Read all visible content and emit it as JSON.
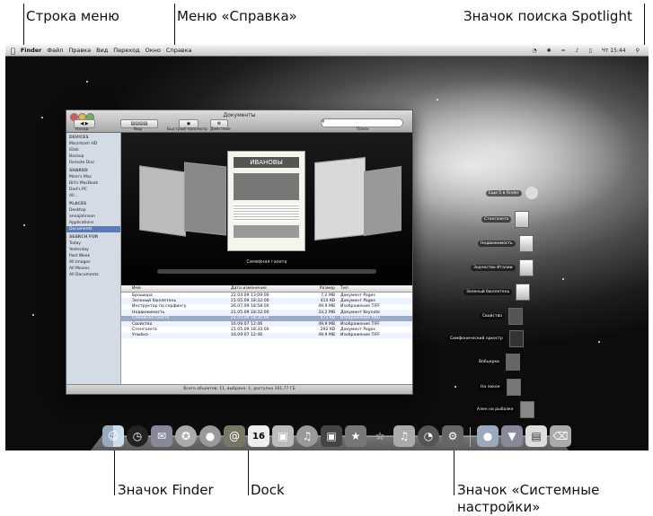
{
  "callouts": {
    "menu_bar": "Строка меню",
    "help_menu": "Меню «Справка»",
    "spotlight": "Значок поиска Spotlight",
    "finder_icon": "Значок Finder",
    "dock": "Dock",
    "sys_prefs_line1": "Значок «Системные",
    "sys_prefs_line2": "настройки»"
  },
  "menubar": {
    "apple": "",
    "items": [
      "Finder",
      "Файл",
      "Правка",
      "Вид",
      "Переход",
      "Окно",
      "Справка"
    ],
    "clock": "Чт 15:44"
  },
  "window": {
    "title": "Документы",
    "toolbar": {
      "back_label": "Назад",
      "view_label": "Вид",
      "quicklook_label": "Быстрый просмотр",
      "action_label": "Действие",
      "search_label": "Поиск"
    },
    "sidebar": {
      "devices_header": "DEVICES",
      "devices": [
        "Macintosh HD",
        "iDisk",
        "Backup",
        "Remote Disc"
      ],
      "shared_header": "SHARED",
      "shared": [
        "Mom's Mac",
        "Bill's MacBook",
        "Dad's PC",
        "All..."
      ],
      "places_header": "PLACES",
      "places": [
        "Desktop",
        "annajohnson",
        "Applications",
        "Documents"
      ],
      "search_header": "SEARCH FOR",
      "search": [
        "Today",
        "Yesterday",
        "Past Week",
        "All Images",
        "All Movies",
        "All Documents"
      ]
    },
    "coverflow": {
      "center_title": "ИВАНОВЫ",
      "caption": "Семейная газета"
    },
    "columns": {
      "name": "Имя",
      "date": "Дата изменения",
      "size": "Размер",
      "type": "Тип"
    },
    "rows": [
      {
        "name": "Брошюра",
        "date": "22.04.09 13:09:00",
        "size": "7,2 MB",
        "type": "Документ Pages"
      },
      {
        "name": "Зеленый бюллетень",
        "date": "21.05.09 18:32:00",
        "size": "410 KB",
        "type": "Документ Pages"
      },
      {
        "name": "Инструктор по серфингу",
        "date": "26.07.09 18:58:00",
        "size": "49,9 MB",
        "type": "Изображение TIFF"
      },
      {
        "name": "Недвижимость",
        "date": "21.05.09 18:32:00",
        "size": "33,2 MB",
        "type": "Документ Keynote"
      },
      {
        "name": "Семейная газета",
        "date": "21.05.09 18:30:00",
        "size": "471 KB",
        "type": "Изображение PNG"
      },
      {
        "name": "Свойство",
        "date": "16.09.07 12:46",
        "size": "49,9 MB",
        "type": "Изображение TIFF"
      },
      {
        "name": "Стенгазета",
        "date": "21.05.09 18:33:00",
        "size": "292 KB",
        "type": "Документ Pages"
      },
      {
        "name": "Улыбка",
        "date": "16.09.07 12:46",
        "size": "49,9 MB",
        "type": "Изображение TIFF"
      }
    ],
    "status": "Всего объектов: 11, выбрано: 1; доступно 161,77 ГБ"
  },
  "stack": [
    "Еще 5 в Finder",
    "Стенгазета",
    "Недвижимость",
    "Зодчество Италии",
    "Зеленый бюллетень",
    "Свойство",
    "Симфонический оркестр",
    "Вебцерки",
    "На покое",
    "Ален на рыбалке"
  ],
  "dock": {
    "icons": [
      "finder-icon",
      "dashboard-icon",
      "mail-icon",
      "safari-icon",
      "ichat-icon",
      "address-book-icon",
      "ical-icon",
      "preview-icon",
      "itunes-icon",
      "photo-icon",
      "star-icon",
      "guitar-icon",
      "time-machine-icon",
      "system-preferences-icon",
      "folder-icon",
      "downloads-icon",
      "document-icon",
      "trash-icon"
    ]
  }
}
